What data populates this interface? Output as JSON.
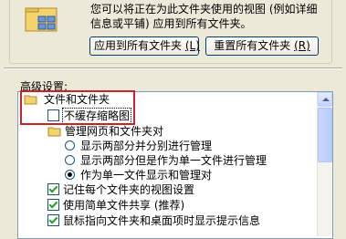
{
  "view_box": {
    "description_line1": "您可以将正在为此文件夹使用的视图 (例如详细",
    "description_line2": "信息或平铺) 应用到所有文件夹。",
    "apply_all_label": "应用到所有文件夹",
    "apply_all_hotkey": "(L)",
    "reset_all_label": "重置所有文件夹",
    "reset_all_hotkey": "(R)"
  },
  "advanced": {
    "label": "高级设置:",
    "items": [
      {
        "kind": "folder",
        "label": "文件和文件夹"
      },
      {
        "kind": "checkbox",
        "checked": false,
        "label": "不缓存缩略图"
      },
      {
        "kind": "folder",
        "label": "管理网页和文件夹对"
      },
      {
        "kind": "radio",
        "checked": false,
        "label": "显示两部分并分别进行管理"
      },
      {
        "kind": "radio",
        "checked": false,
        "label": "显示两部分但是作为单一文件进行管理"
      },
      {
        "kind": "radio",
        "checked": true,
        "label": "作为单一文件显示和管理对"
      },
      {
        "kind": "checkbox",
        "checked": true,
        "label": "记住每个文件夹的视图设置"
      },
      {
        "kind": "checkbox",
        "checked": true,
        "label": "使用简单文件共享 (推荐)"
      },
      {
        "kind": "checkbox",
        "checked": true,
        "label": "鼠标指向文件夹和桌面项时显示提示信息"
      }
    ]
  },
  "colors": {
    "highlight_box": "#c8232a",
    "dialog_bg": "#ece9d8"
  }
}
